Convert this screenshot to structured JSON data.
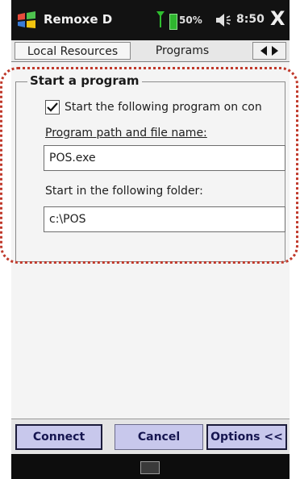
{
  "status_bar": {
    "title": "Remoxe D",
    "battery": "50%",
    "time": "8:50",
    "close": "X"
  },
  "tabs": [
    {
      "label": "Local Resources"
    },
    {
      "label": "Programs"
    }
  ],
  "group": {
    "legend": "Start a program",
    "checkbox_label": "Start the following program on con",
    "checkbox_checked": true,
    "path_label": "Program path and file name:",
    "path_value": "POS.exe",
    "folder_label": "Start in the following folder:",
    "folder_value": "c:\\POS"
  },
  "buttons": {
    "connect": "Connect",
    "cancel": "Cancel",
    "options": "Options <<"
  },
  "icons": {
    "windows_logo": "windows-logo-icon",
    "signal": "signal-icon",
    "battery": "battery-icon",
    "speaker": "speaker-icon",
    "keyboard": "keyboard-icon"
  },
  "colors": {
    "highlight": "#c0392b",
    "button_bg": "#c8c8ec",
    "status_bg": "#121212"
  }
}
